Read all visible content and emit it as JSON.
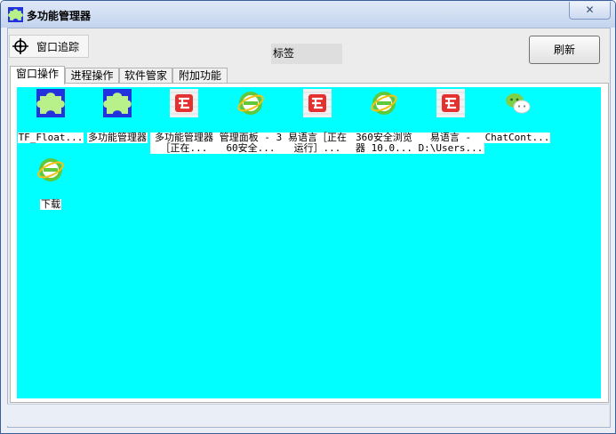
{
  "window": {
    "title": "多功能管理器",
    "close_symbol": "✕"
  },
  "toolbar": {
    "track_label": "窗口追踪",
    "tag_label": "标签",
    "refresh_label": "刷新"
  },
  "tabs": [
    {
      "label": "窗口操作",
      "active": true
    },
    {
      "label": "进程操作",
      "active": false
    },
    {
      "label": "软件管家",
      "active": false
    },
    {
      "label": "附加功能",
      "active": false
    }
  ],
  "colors": {
    "list_background": "#00ffff",
    "title_bar": "#c4d4ee"
  },
  "items": [
    {
      "icon": "puzzle-icon",
      "label": "TF_Float..."
    },
    {
      "icon": "puzzle-icon",
      "label": "多功能管理器"
    },
    {
      "icon": "e-language-icon",
      "label": "多功能管理器［正在..."
    },
    {
      "icon": "ie-browser-icon",
      "label": "管理面板 - 360安全..."
    },
    {
      "icon": "e-language-icon",
      "label": "易语言［正在运行］..."
    },
    {
      "icon": "ie-browser-icon",
      "label": "360安全浏览器 10.0..."
    },
    {
      "icon": "e-language-icon",
      "label": "易语言 - D:\\Users..."
    },
    {
      "icon": "wechat-icon",
      "label": "ChatCont..."
    },
    {
      "icon": "ie-browser-icon",
      "label": "下载"
    }
  ]
}
